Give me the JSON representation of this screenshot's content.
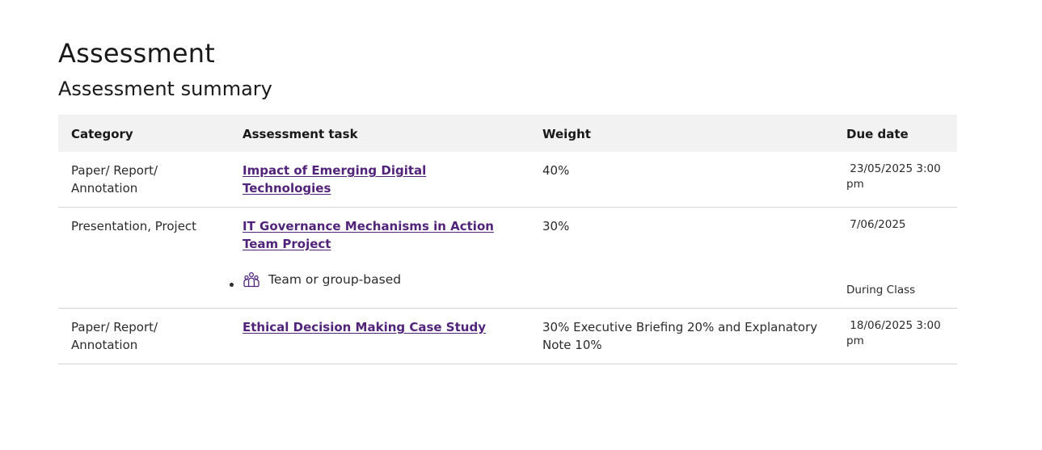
{
  "page": {
    "title": "Assessment",
    "section_title": "Assessment summary"
  },
  "table": {
    "headers": {
      "category": "Category",
      "task": "Assessment task",
      "weight": "Weight",
      "due": "Due date"
    },
    "rows": [
      {
        "category": "Paper/ Report/ Annotation",
        "task": "Impact of Emerging Digital Technologies",
        "weight": "40%",
        "due": " 23/05/2025 3:00 pm"
      },
      {
        "category": "Presentation, Project",
        "task": "IT Governance Mechanisms in Action Team Project",
        "task_meta": "Team or group-based",
        "task_meta_icon": "group-icon",
        "weight": "30%",
        "due": " 7/06/2025",
        "due_note": "During Class"
      },
      {
        "category": "Paper/ Report/ Annotation",
        "task": "Ethical Decision Making Case Study",
        "weight": "30% Executive Briefing 20% and Explanatory Note 10%",
        "due": " 18/06/2025 3:00 pm"
      }
    ]
  },
  "colors": {
    "link": "#51247a",
    "header_bg": "#f2f2f2",
    "row_border": "#d6d6d6"
  }
}
